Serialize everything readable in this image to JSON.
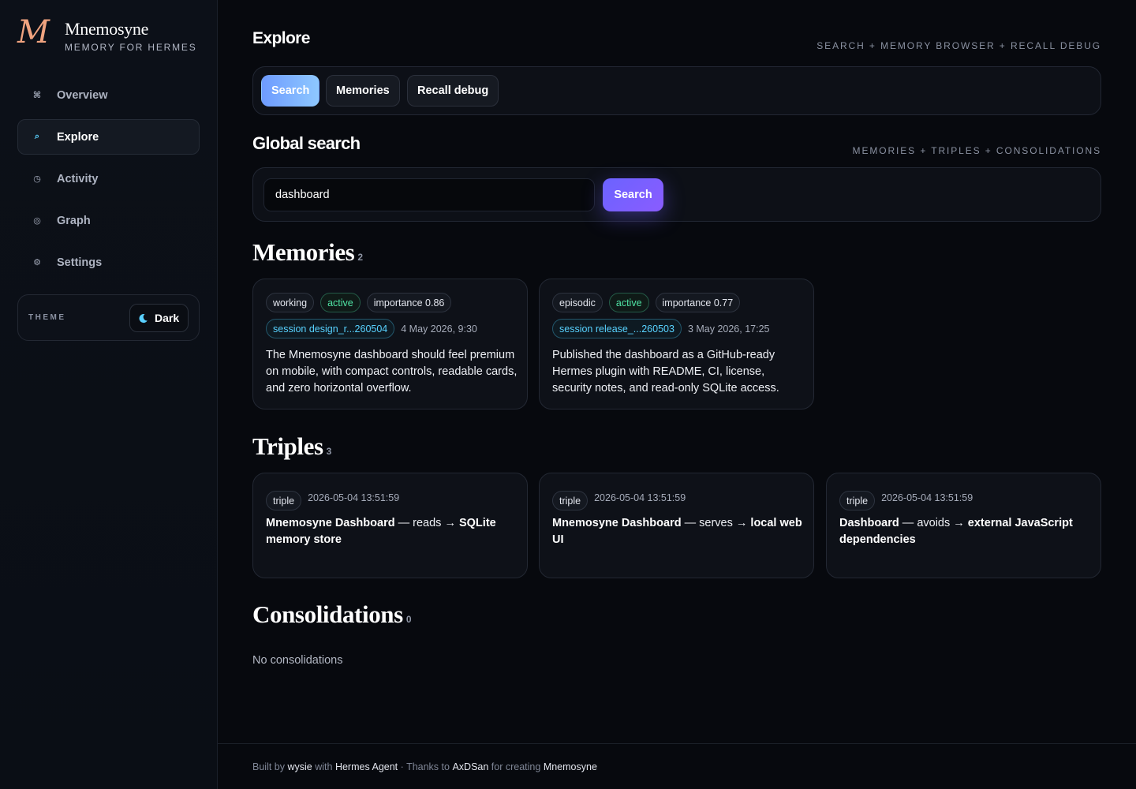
{
  "brand": {
    "mark": "M",
    "name": "Mnemosyne",
    "subtitle": "MEMORY FOR HERMES"
  },
  "nav": {
    "items": [
      {
        "label": "Overview",
        "icon": "⌘"
      },
      {
        "label": "Explore",
        "icon": "⌕"
      },
      {
        "label": "Activity",
        "icon": "◷"
      },
      {
        "label": "Graph",
        "icon": "◎"
      },
      {
        "label": "Settings",
        "icon": "⚙"
      }
    ],
    "active": "Explore"
  },
  "theme": {
    "label": "THEME",
    "value": "Dark"
  },
  "explore": {
    "title": "Explore",
    "kicker": "SEARCH + MEMORY BROWSER + RECALL DEBUG",
    "tabs": [
      "Search",
      "Memories",
      "Recall debug"
    ],
    "active_tab": "Search"
  },
  "global_search": {
    "title": "Global search",
    "kicker": "MEMORIES + TRIPLES + CONSOLIDATIONS",
    "query": "dashboard",
    "button": "Search"
  },
  "memories": {
    "title": "Memories",
    "count": "2",
    "items": [
      {
        "type": "working",
        "status": "active",
        "importance": "importance 0.86",
        "session": "session design_r...260504",
        "date": "4 May 2026, 9:30",
        "text": "The Mnemosyne dashboard should feel premium on mobile, with compact controls, readable cards, and zero horizontal overflow."
      },
      {
        "type": "episodic",
        "status": "active",
        "importance": "importance 0.77",
        "session": "session release_...260503",
        "date": "3 May 2026, 17:25",
        "text": "Published the dashboard as a GitHub-ready Hermes plugin with README, CI, license, security notes, and read-only SQLite access."
      }
    ]
  },
  "triples": {
    "title": "Triples",
    "count": "3",
    "items": [
      {
        "tag": "triple",
        "timestamp": "2026-05-04 13:51:59",
        "subject": "Mnemosyne Dashboard",
        "predicate": "reads",
        "object": "SQLite memory store"
      },
      {
        "tag": "triple",
        "timestamp": "2026-05-04 13:51:59",
        "subject": "Mnemosyne Dashboard",
        "predicate": "serves",
        "object": "local web UI"
      },
      {
        "tag": "triple",
        "timestamp": "2026-05-04 13:51:59",
        "subject": "Dashboard",
        "predicate": "avoids",
        "object": "external JavaScript dependencies"
      }
    ]
  },
  "consolidations": {
    "title": "Consolidations",
    "count": "0",
    "empty": "No consolidations"
  },
  "footer": {
    "built_by": "Built by",
    "author": "wysie",
    "with": "with",
    "tool": "Hermes Agent",
    "thanks": "· Thanks to",
    "creator": "AxDSan",
    "for_creating": "for creating",
    "project": "Mnemosyne"
  }
}
